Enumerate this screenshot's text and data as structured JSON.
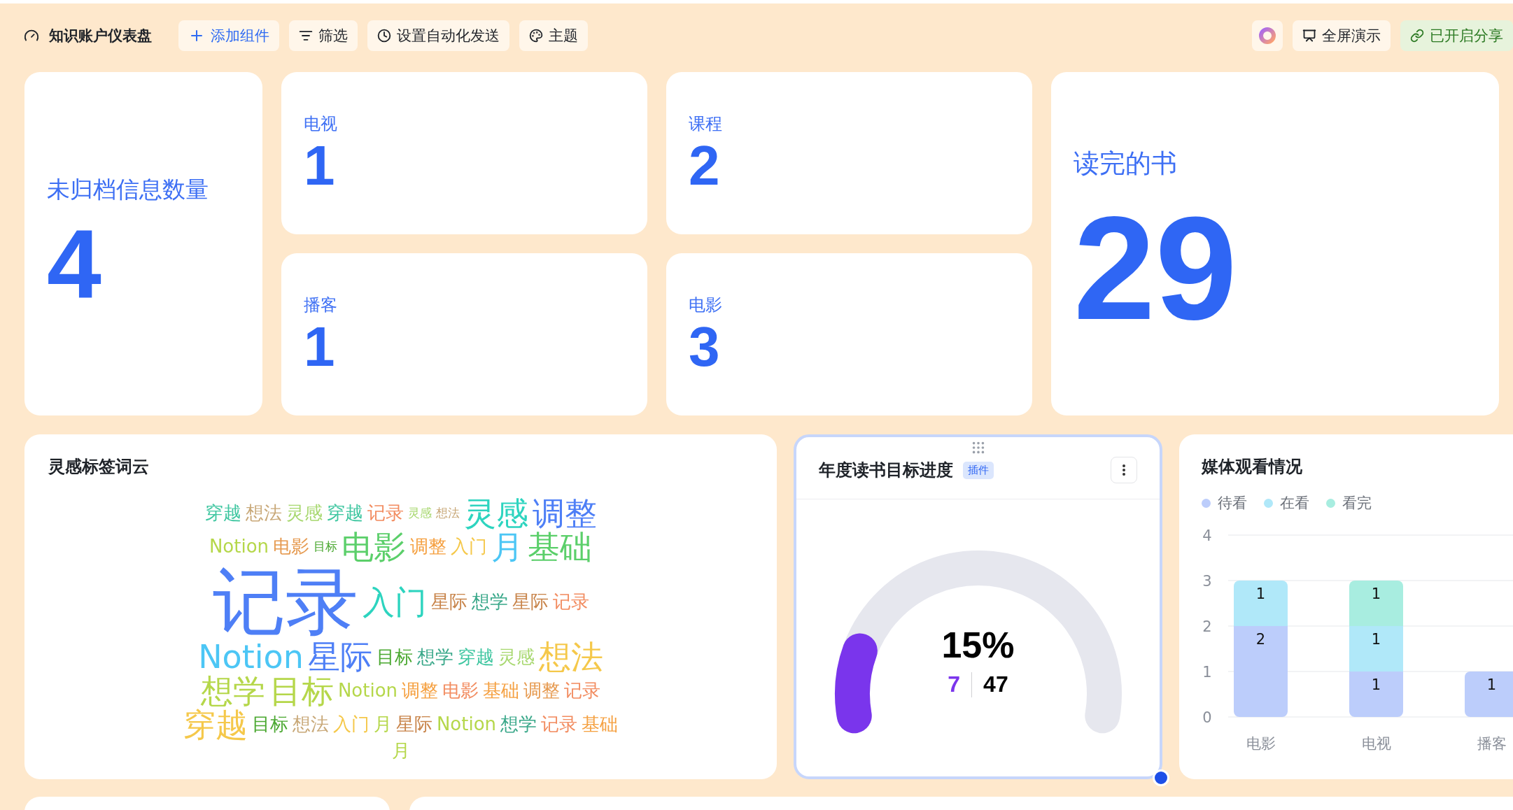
{
  "toolbar": {
    "title": "知识账户仪表盘",
    "buttons": [
      {
        "label": "添加组件",
        "kind": "add"
      },
      {
        "label": "筛选",
        "kind": "filter"
      },
      {
        "label": "设置自动化发送",
        "kind": "schedule"
      },
      {
        "label": "主题",
        "kind": "theme"
      }
    ],
    "right_buttons": [
      {
        "kind": "ai"
      },
      {
        "label": "全屏演示",
        "kind": "present"
      },
      {
        "label": "已开启分享",
        "kind": "share"
      }
    ]
  },
  "stats": [
    {
      "label": "未归档信息数量",
      "value": "4",
      "kind": "tall"
    },
    {
      "label": "电视",
      "value": "1",
      "kind": "small"
    },
    {
      "label": "课程",
      "value": "2",
      "kind": "small"
    },
    {
      "label": "读完的书",
      "value": "29",
      "kind": "big"
    },
    {
      "label": "播客",
      "value": "1",
      "kind": "small"
    },
    {
      "label": "电影",
      "value": "3",
      "kind": "small"
    }
  ],
  "word_cloud": {
    "title": "灵感标签词云",
    "words": [
      {
        "text": "穿越",
        "kind": "m",
        "color": "#3ec6a0"
      },
      {
        "text": "想法",
        "kind": "m",
        "color": "#c8a878"
      },
      {
        "text": "灵感",
        "kind": "m",
        "color": "#a8d870"
      },
      {
        "text": "穿越",
        "kind": "m",
        "color": "#3ec6a0"
      },
      {
        "text": "记录",
        "kind": "m",
        "color": "#f28c60"
      },
      {
        "text": "灵感",
        "kind": "s",
        "color": "#a8d870"
      },
      {
        "text": "想法",
        "kind": "s",
        "color": "#c8a878"
      },
      {
        "text": "灵感",
        "kind": "l",
        "color": "#2dd4bf"
      },
      {
        "text": "调整",
        "kind": "l",
        "color": "#4e7ff6"
      },
      {
        "text": "Notion",
        "kind": "m",
        "color": "#b5d74a"
      },
      {
        "text": "电影",
        "kind": "m",
        "color": "#e69a50"
      },
      {
        "text": "目标",
        "kind": "s",
        "color": "#4aa830"
      },
      {
        "text": "电影",
        "kind": "l",
        "color": "#5bcf6a"
      },
      {
        "text": "调整",
        "kind": "m",
        "color": "#f5a040"
      },
      {
        "text": "入门",
        "kind": "m",
        "color": "#f5c84a"
      },
      {
        "text": "月",
        "kind": "l",
        "color": "#4cc6f5"
      },
      {
        "text": "基础",
        "kind": "l",
        "color": "#5bcf6a"
      },
      {
        "text": "记录",
        "kind": "xl",
        "color": "#4e7ff6"
      },
      {
        "text": "入门",
        "kind": "l",
        "color": "#2dd4bf"
      },
      {
        "text": "星际",
        "kind": "m",
        "color": "#c8844a"
      },
      {
        "text": "想学",
        "kind": "m",
        "color": "#3aa88a"
      },
      {
        "text": "星际",
        "kind": "m",
        "color": "#c8844a"
      },
      {
        "text": "记录",
        "kind": "m",
        "color": "#f28c60"
      },
      {
        "text": "Notion",
        "kind": "l",
        "color": "#4cc6f5"
      },
      {
        "text": "星际",
        "kind": "l",
        "color": "#4e7ff6"
      },
      {
        "text": "目标",
        "kind": "m",
        "color": "#4aa830"
      },
      {
        "text": "想学",
        "kind": "m",
        "color": "#3aa88a"
      },
      {
        "text": "穿越",
        "kind": "m",
        "color": "#3ec6a0"
      },
      {
        "text": "灵感",
        "kind": "m",
        "color": "#a8d870"
      },
      {
        "text": "想法",
        "kind": "l",
        "color": "#f5c84a"
      },
      {
        "text": "想学",
        "kind": "l",
        "color": "#b5d74a"
      },
      {
        "text": "目标",
        "kind": "l",
        "color": "#b5d74a"
      },
      {
        "text": "Notion",
        "kind": "m",
        "color": "#b5d74a"
      },
      {
        "text": "调整",
        "kind": "m",
        "color": "#f5a040"
      },
      {
        "text": "电影",
        "kind": "m",
        "color": "#f28c60"
      },
      {
        "text": "基础",
        "kind": "m",
        "color": "#f5a040"
      },
      {
        "text": "调整",
        "kind": "m",
        "color": "#e69a50"
      },
      {
        "text": "记录",
        "kind": "m",
        "color": "#f28c60"
      },
      {
        "text": "穿越",
        "kind": "l",
        "color": "#f5c84a"
      },
      {
        "text": "目标",
        "kind": "m",
        "color": "#4aa830"
      },
      {
        "text": "想法",
        "kind": "m",
        "color": "#c8a878"
      },
      {
        "text": "入门",
        "kind": "m",
        "color": "#f5c84a"
      },
      {
        "text": "月",
        "kind": "m",
        "color": "#b5d74a"
      },
      {
        "text": "星际",
        "kind": "m",
        "color": "#c8844a"
      },
      {
        "text": "Notion",
        "kind": "m",
        "color": "#b5d74a"
      },
      {
        "text": "想学",
        "kind": "m",
        "color": "#3aa88a"
      },
      {
        "text": "记录",
        "kind": "m",
        "color": "#f28c60"
      },
      {
        "text": "基础",
        "kind": "m",
        "color": "#f5a040"
      },
      {
        "text": "月",
        "kind": "m",
        "color": "#b5d74a"
      }
    ]
  },
  "goal": {
    "title": "年度读书目标进度",
    "badge": "插件",
    "percent": "15%",
    "done": "7",
    "total": "47",
    "level": 0.15
  },
  "media_chart": {
    "title": "媒体观看情况",
    "chart_data": {
      "type": "bar",
      "stacked": true,
      "categories": [
        "电影",
        "电视",
        "播客"
      ],
      "series": [
        {
          "name": "待看",
          "color": "#bccdfb",
          "values": [
            2,
            1,
            1
          ]
        },
        {
          "name": "在看",
          "color": "#b0e8f9",
          "values": [
            1,
            1,
            null
          ]
        },
        {
          "name": "看完",
          "color": "#a8ede0",
          "values": [
            null,
            1,
            null
          ]
        }
      ],
      "ylim": [
        0,
        4
      ],
      "yticks": [
        0,
        1,
        2,
        3,
        4
      ],
      "grid": true,
      "data_labels": true
    }
  }
}
